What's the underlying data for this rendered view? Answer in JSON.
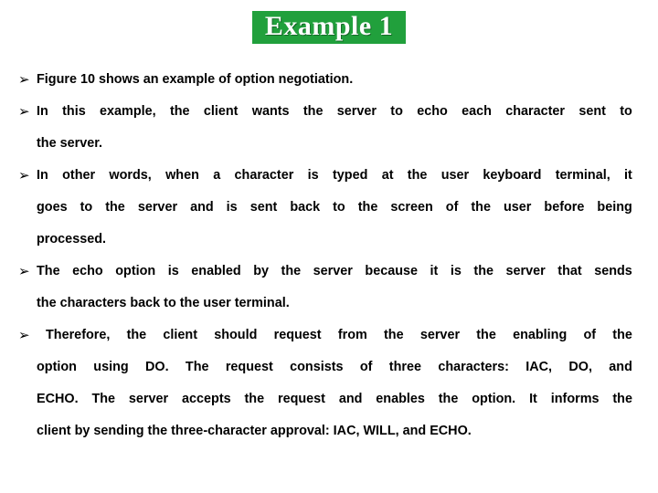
{
  "slide": {
    "title": "Example 1",
    "title_bg_color": "#21a03c",
    "title_text_color": "#ffffff",
    "background_color": "#ffffff",
    "text_color": "#000000",
    "bullet_glyph": "➢",
    "bullets": [
      {
        "id": "bullet-figure-10",
        "marker": "➢",
        "lines": [
          {
            "text": "Figure 10 shows an example of option negotiation.",
            "justify": false,
            "lead_space": false
          }
        ]
      },
      {
        "id": "bullet-client-echo",
        "marker": "➢",
        "lines": [
          {
            "text": "In this example, the client wants the server to echo each character sent to",
            "justify": true,
            "lead_space": false
          },
          {
            "text": "the server.",
            "justify": false,
            "lead_space": false
          }
        ]
      },
      {
        "id": "bullet-keyboard-terminal",
        "marker": "➢",
        "lines": [
          {
            "text": "In other words, when a character is typed at the user keyboard terminal, it",
            "justify": true,
            "lead_space": false
          },
          {
            "text": "goes to the server and is sent back to the screen of the user before being",
            "justify": true,
            "lead_space": false
          },
          {
            "text": "processed.",
            "justify": false,
            "lead_space": false
          }
        ]
      },
      {
        "id": "bullet-echo-option-enabled",
        "marker": "➢",
        "lines": [
          {
            "text": "The echo option is enabled by the server because it is the server that sends",
            "justify": true,
            "lead_space": false
          },
          {
            "text": "the characters back to the user terminal.",
            "justify": false,
            "lead_space": false
          }
        ]
      },
      {
        "id": "bullet-therefore-request",
        "marker": "➢",
        "lines": [
          {
            "text": "Therefore, the client should request from the server the enabling of the",
            "justify": true,
            "lead_space": true
          },
          {
            "text": "option using DO. The request consists of three characters: IAC, DO, and",
            "justify": true,
            "lead_space": false
          },
          {
            "text": "ECHO. The server accepts the request and enables the option. It informs the",
            "justify": true,
            "lead_space": false
          },
          {
            "text": "client by sending the three-character approval: IAC, WILL, and ECHO.",
            "justify": false,
            "lead_space": false
          }
        ]
      }
    ]
  }
}
